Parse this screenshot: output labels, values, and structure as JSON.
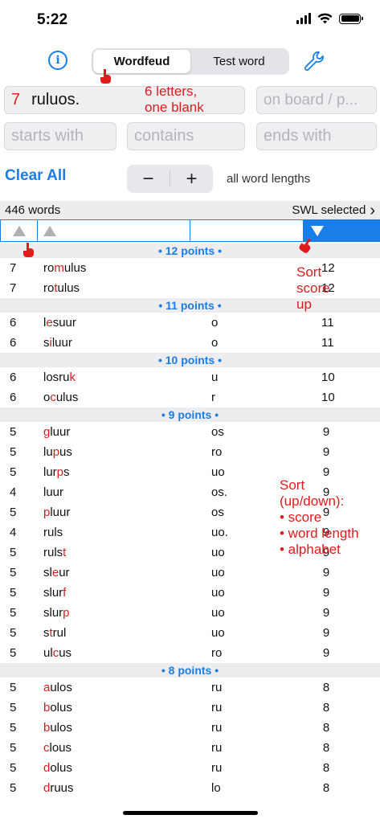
{
  "status": {
    "time": "5:22"
  },
  "toolbar": {
    "segments": [
      "Wordfeud",
      "Test word"
    ],
    "selected": 0
  },
  "inputs": {
    "blank_count": "7",
    "letters": "ruluos.",
    "board_placeholder": "on board / p...",
    "starts_placeholder": "starts with",
    "contains_placeholder": "contains",
    "ends_placeholder": "ends with"
  },
  "controls": {
    "clear_all": "Clear All",
    "minus": "−",
    "plus": "+",
    "lengths": "all word lengths"
  },
  "summary": {
    "count": "446 words",
    "list": "SWL selected",
    "chevron": "›"
  },
  "accent": "#1a7ee6",
  "highlight": "#d32020",
  "sections": [
    {
      "header": "• 12 points •",
      "rows": [
        {
          "len": "7",
          "word": [
            [
              "ro",
              ""
            ],
            [
              "m",
              "hl"
            ],
            [
              "ulus",
              ""
            ]
          ],
          "rem": "",
          "score": "12"
        },
        {
          "len": "7",
          "word": [
            [
              "ro",
              ""
            ],
            [
              "t",
              "hl"
            ],
            [
              "ulus",
              ""
            ]
          ],
          "rem": "",
          "score": "12"
        }
      ]
    },
    {
      "header": "• 11 points •",
      "rows": [
        {
          "len": "6",
          "word": [
            [
              "l",
              ""
            ],
            [
              "e",
              "hl"
            ],
            [
              "suur",
              ""
            ]
          ],
          "rem": "o",
          "score": "11"
        },
        {
          "len": "6",
          "word": [
            [
              "s",
              ""
            ],
            [
              "i",
              "hl"
            ],
            [
              "luur",
              ""
            ]
          ],
          "rem": "o",
          "score": "11"
        }
      ]
    },
    {
      "header": "• 10 points •",
      "rows": [
        {
          "len": "6",
          "word": [
            [
              "losru",
              ""
            ],
            [
              "k",
              "hl"
            ]
          ],
          "rem": "u",
          "score": "10"
        },
        {
          "len": "6",
          "word": [
            [
              "o",
              ""
            ],
            [
              "c",
              "hl"
            ],
            [
              "ulus",
              ""
            ]
          ],
          "rem": "r",
          "score": "10"
        }
      ]
    },
    {
      "header": "• 9 points •",
      "rows": [
        {
          "len": "5",
          "word": [
            [
              "g",
              "hl"
            ],
            [
              "luur",
              ""
            ]
          ],
          "rem": "os",
          "score": "9"
        },
        {
          "len": "5",
          "word": [
            [
              "lu",
              ""
            ],
            [
              "p",
              "hl"
            ],
            [
              "us",
              ""
            ]
          ],
          "rem": "ro",
          "score": "9"
        },
        {
          "len": "5",
          "word": [
            [
              "lur",
              ""
            ],
            [
              "p",
              "hl"
            ],
            [
              "s",
              ""
            ]
          ],
          "rem": "uo",
          "score": "9"
        },
        {
          "len": "4",
          "word": [
            [
              "luur",
              ""
            ]
          ],
          "rem": "os.",
          "score": "9"
        },
        {
          "len": "5",
          "word": [
            [
              "p",
              "hl"
            ],
            [
              "luur",
              ""
            ]
          ],
          "rem": "os",
          "score": "9"
        },
        {
          "len": "4",
          "word": [
            [
              "ruls",
              ""
            ]
          ],
          "rem": "uo.",
          "score": "9"
        },
        {
          "len": "5",
          "word": [
            [
              "ruls",
              ""
            ],
            [
              "t",
              "hl"
            ]
          ],
          "rem": "uo",
          "score": "9"
        },
        {
          "len": "5",
          "word": [
            [
              "sl",
              ""
            ],
            [
              "e",
              "hl"
            ],
            [
              "ur",
              ""
            ]
          ],
          "rem": "uo",
          "score": "9"
        },
        {
          "len": "5",
          "word": [
            [
              "slur",
              ""
            ],
            [
              "f",
              "hl"
            ]
          ],
          "rem": "uo",
          "score": "9"
        },
        {
          "len": "5",
          "word": [
            [
              "slur",
              ""
            ],
            [
              "p",
              "hl"
            ]
          ],
          "rem": "uo",
          "score": "9"
        },
        {
          "len": "5",
          "word": [
            [
              "s",
              ""
            ],
            [
              "t",
              "hl"
            ],
            [
              "rul",
              ""
            ]
          ],
          "rem": "uo",
          "score": "9"
        },
        {
          "len": "5",
          "word": [
            [
              "ul",
              ""
            ],
            [
              "c",
              "hl"
            ],
            [
              "us",
              ""
            ]
          ],
          "rem": "ro",
          "score": "9"
        }
      ]
    },
    {
      "header": "• 8 points •",
      "rows": [
        {
          "len": "5",
          "word": [
            [
              "a",
              "hl"
            ],
            [
              "ulos",
              ""
            ]
          ],
          "rem": "ru",
          "score": "8"
        },
        {
          "len": "5",
          "word": [
            [
              "b",
              "hl"
            ],
            [
              "olus",
              ""
            ]
          ],
          "rem": "ru",
          "score": "8"
        },
        {
          "len": "5",
          "word": [
            [
              "b",
              "hl"
            ],
            [
              "ulos",
              ""
            ]
          ],
          "rem": "ru",
          "score": "8"
        },
        {
          "len": "5",
          "word": [
            [
              "c",
              "hl"
            ],
            [
              "lous",
              ""
            ]
          ],
          "rem": "ru",
          "score": "8"
        },
        {
          "len": "5",
          "word": [
            [
              "d",
              "hl"
            ],
            [
              "olus",
              ""
            ]
          ],
          "rem": "ru",
          "score": "8"
        },
        {
          "len": "5",
          "word": [
            [
              "d",
              "hl"
            ],
            [
              "ruus",
              ""
            ]
          ],
          "rem": "lo",
          "score": "8"
        }
      ]
    }
  ],
  "annotations": {
    "a1": "6 letters,\none blank",
    "a2": "Sort\nscore\nup",
    "a3": "Sort\n(up/down):\n• score\n• word length\n• alphabet"
  }
}
